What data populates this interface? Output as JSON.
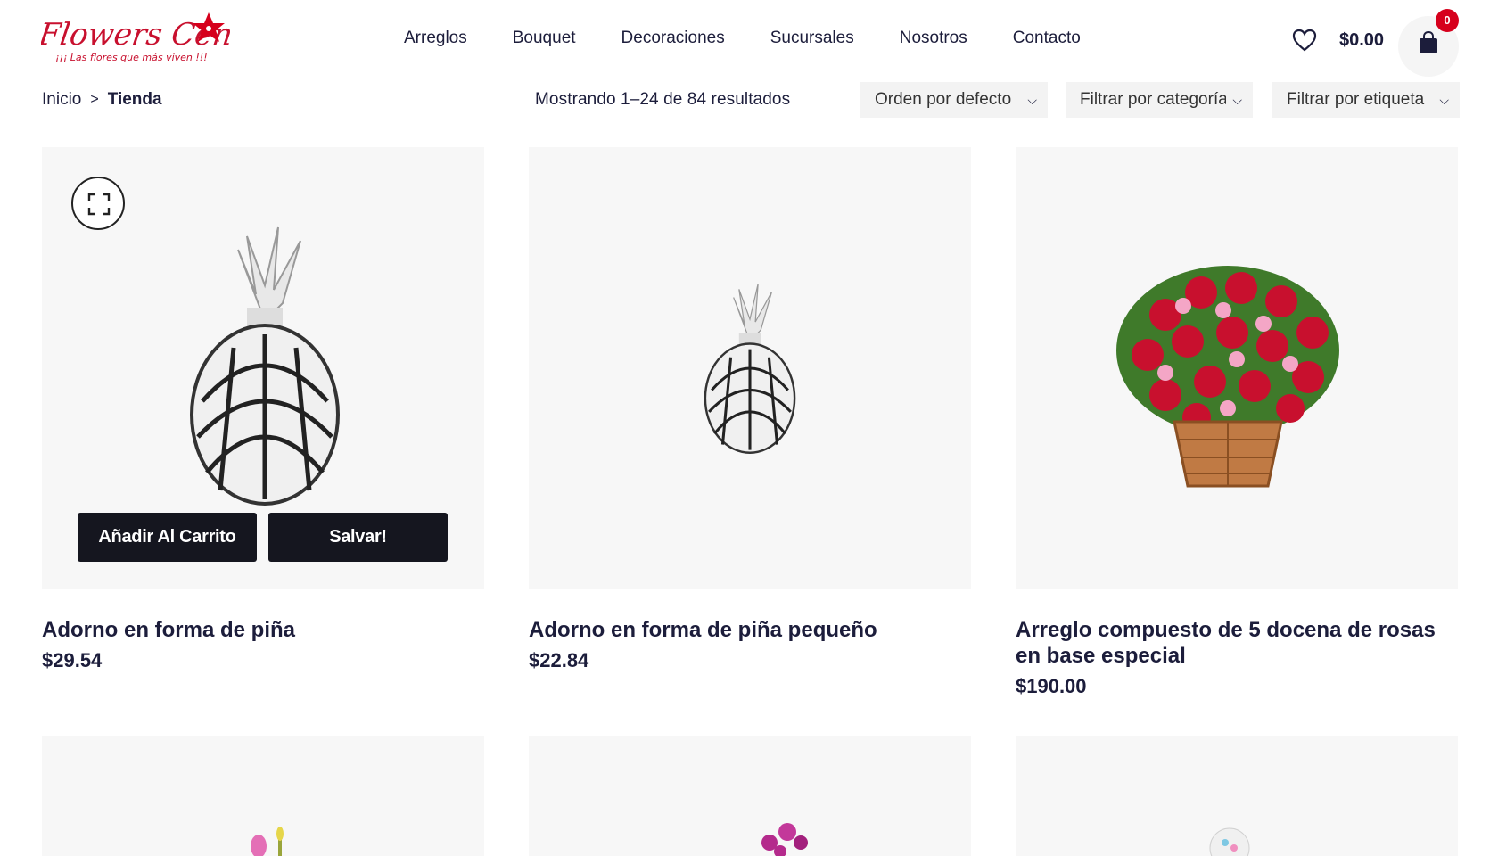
{
  "brand": {
    "name": "Flowers Center",
    "tagline": "¡¡¡ Las flores que más viven !!!",
    "accent": "#d6001c"
  },
  "nav": {
    "items": [
      "Arreglos",
      "Bouquet",
      "Decoraciones",
      "Sucursales",
      "Nosotros",
      "Contacto"
    ]
  },
  "header": {
    "wishlist_icon": "heart-icon",
    "cart_total": "$0.00",
    "cart_icon": "shopping-bag-icon",
    "cart_count": "0"
  },
  "breadcrumb": {
    "home": "Inicio",
    "separator": ">",
    "current": "Tienda"
  },
  "results_text": "Mostrando 1–24 de 84 resultados",
  "filters": {
    "order": "Orden por defecto",
    "category": "Filtrar por categoría",
    "tag": "Filtrar por etiqueta"
  },
  "products": [
    {
      "title": "Adorno en forma de piña",
      "price": "$29.54",
      "add_to_cart": "Añadir Al Carrito",
      "save": "Salvar!"
    },
    {
      "title": "Adorno en forma de piña pequeño",
      "price": "$22.84"
    },
    {
      "title": "Arreglo compuesto de 5 docena de rosas en base especial",
      "price": "$190.00"
    }
  ],
  "colors": {
    "text_dark": "#1c1d3b",
    "card_bg": "#f7f7f7",
    "button_dark": "#15161f",
    "badge_red": "#d6001c"
  }
}
